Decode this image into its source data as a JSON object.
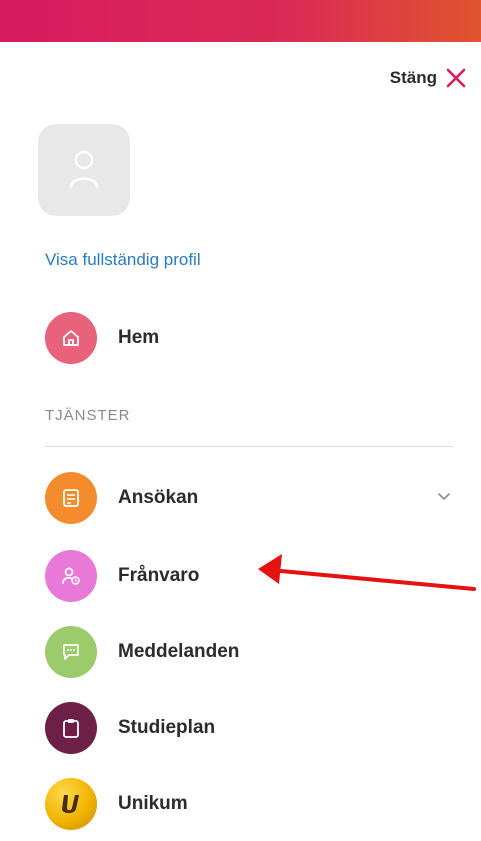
{
  "header": {
    "close_label": "Stäng"
  },
  "profile": {
    "link_label": "Visa fullständig profil"
  },
  "nav": {
    "home": {
      "label": "Hem",
      "icon": "home-icon",
      "color": "#e8627c"
    },
    "section_label": "TJÄNSTER",
    "services": [
      {
        "label": "Ansökan",
        "icon": "document-icon",
        "color": "#f48c2e",
        "expandable": true
      },
      {
        "label": "Frånvaro",
        "icon": "absence-icon",
        "color": "#e879d9"
      },
      {
        "label": "Meddelanden",
        "icon": "chat-icon",
        "color": "#9ccb6b"
      },
      {
        "label": "Studieplan",
        "icon": "clipboard-icon",
        "color": "#6d1f45"
      },
      {
        "label": "Unikum",
        "icon": "unikum-logo-icon",
        "color": "#f0b400"
      }
    ]
  },
  "colors": {
    "topbar_start": "#d81b60",
    "topbar_end": "#e0542f",
    "close_x": "#d81b60",
    "link": "#2a7bbf",
    "annotation_arrow": "#e51212"
  }
}
